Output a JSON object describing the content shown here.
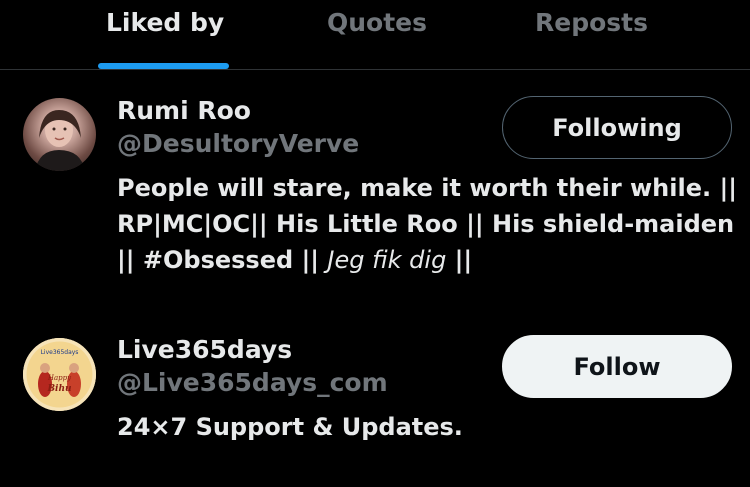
{
  "tabs": [
    {
      "label": "Liked by",
      "active": true
    },
    {
      "label": "Quotes",
      "active": false
    },
    {
      "label": "Reposts",
      "active": false
    }
  ],
  "accent_color": "#1d9bf0",
  "users": [
    {
      "name": "Rumi Roo",
      "handle": "@DesultoryVerve",
      "button_label": "Following",
      "bio_main": "People will stare, make it worth their while. || RP|MC|OC|| His Little Roo || His shield-maiden || #Obsessed || ",
      "bio_italic": "Jeg fik dig",
      "bio_end": " ||"
    },
    {
      "name": "Live365days",
      "handle": "@Live365days_com",
      "button_label": "Follow",
      "bio_main": "24×7 Support & Updates.",
      "avatar_top_text": "Live365days",
      "avatar_greeting_1": "Happy",
      "avatar_greeting_2": "Bihu"
    }
  ]
}
